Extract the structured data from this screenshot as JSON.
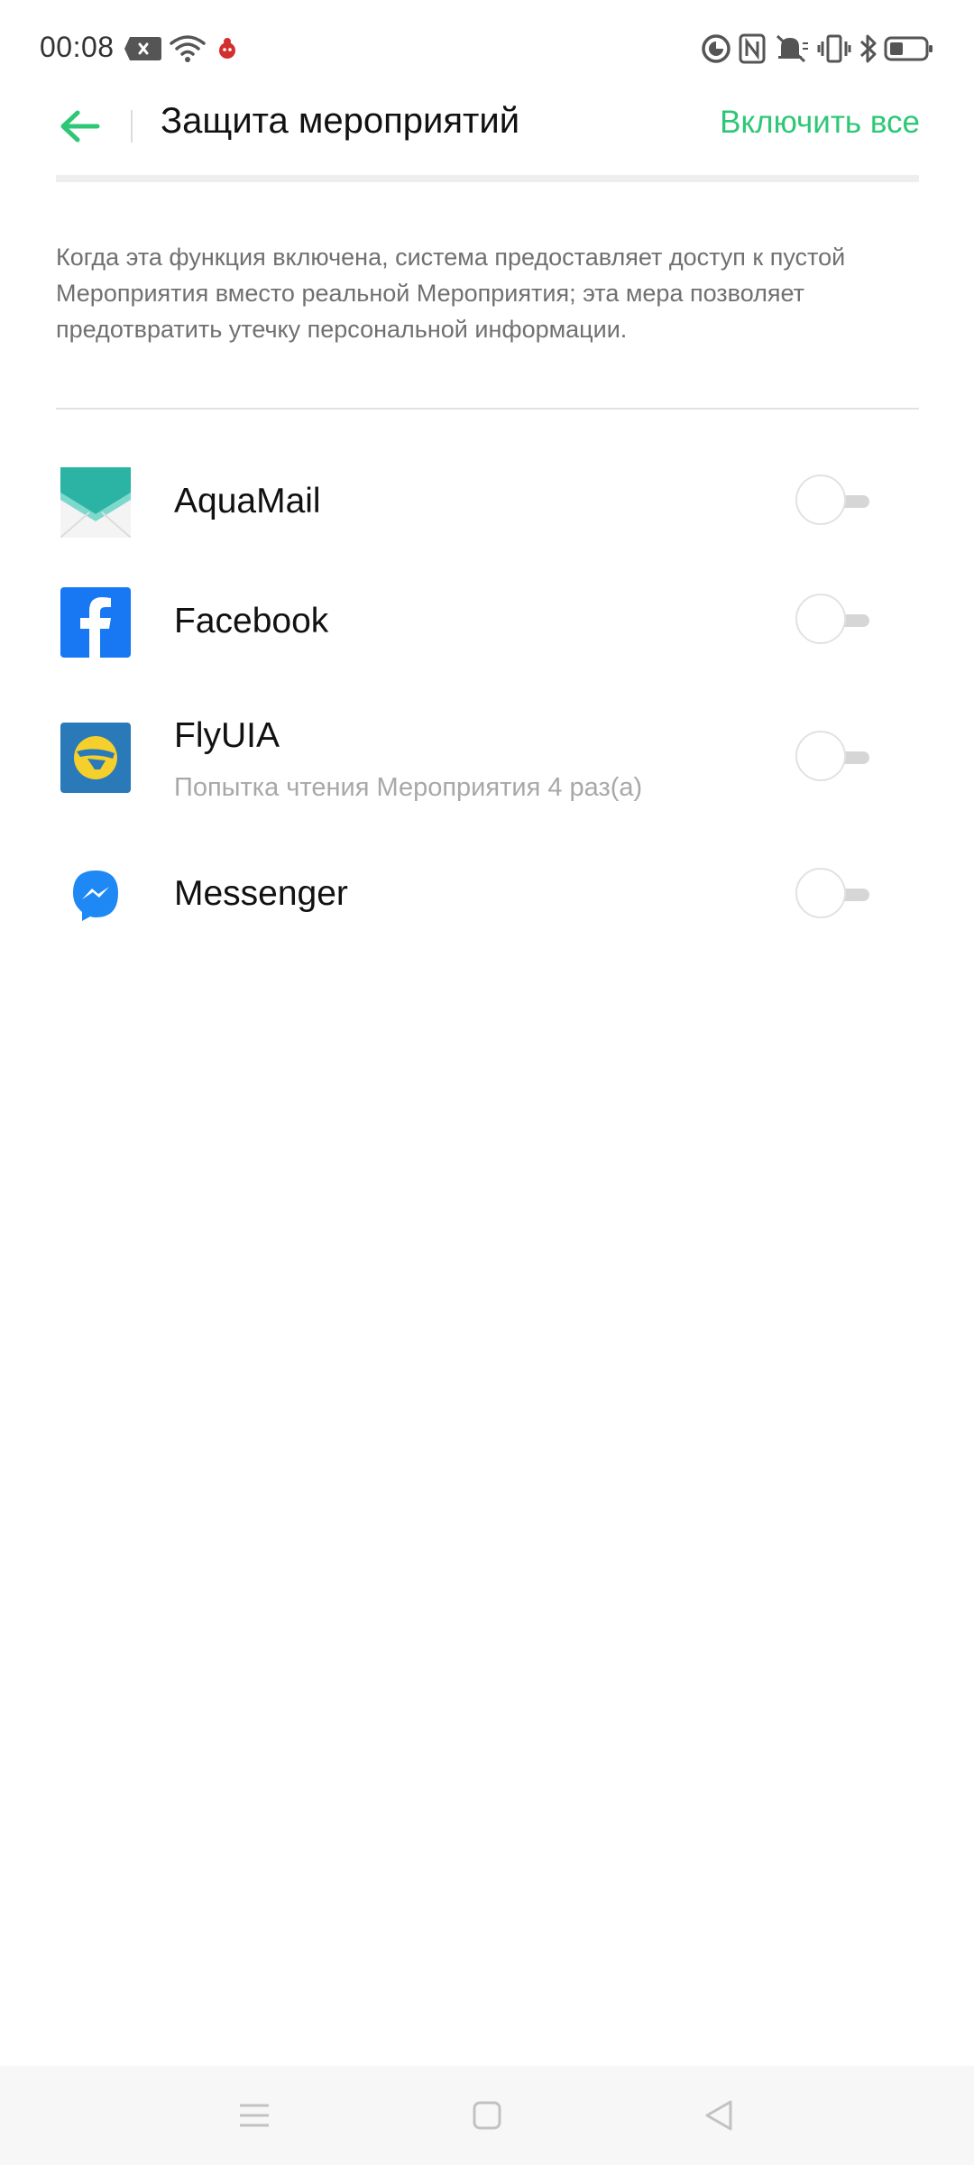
{
  "status_bar": {
    "time": "00:08",
    "icons": [
      "close-notification-icon",
      "wifi-icon",
      "bug-icon",
      "data-saver-icon",
      "nfc-icon",
      "mute-icon",
      "vibrate-icon",
      "bluetooth-icon",
      "battery-icon"
    ]
  },
  "header": {
    "title": "Защита мероприятий",
    "action_label": "Включить все",
    "accent_color": "#2ec776"
  },
  "description": "Когда эта функция включена, система предоставляет доступ к пустой Мероприятия вместо реальной Мероприятия; эта мера позволяет предотвратить утечку персональной информации.",
  "apps": [
    {
      "name": "AquaMail",
      "subtitle": "",
      "enabled": false,
      "icon": "aquamail-icon"
    },
    {
      "name": "Facebook",
      "subtitle": "",
      "enabled": false,
      "icon": "facebook-icon"
    },
    {
      "name": "FlyUIA",
      "subtitle": "Попытка чтения Мероприятия 4 раз(а)",
      "enabled": false,
      "icon": "flyuia-icon"
    },
    {
      "name": "Messenger",
      "subtitle": "",
      "enabled": false,
      "icon": "messenger-icon"
    }
  ],
  "nav_bar": {
    "buttons": [
      "menu-icon",
      "home-icon",
      "back-triangle-icon"
    ]
  }
}
